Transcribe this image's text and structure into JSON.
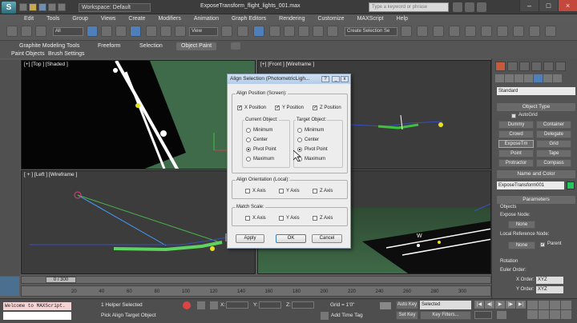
{
  "app": {
    "logo": "S",
    "title": "ExposeTransform_flight_lights_001.max",
    "workspace": "Workspace: Default",
    "search_placeholder": "Type a keyword or phrase",
    "window_buttons": [
      "–",
      "□",
      "×"
    ]
  },
  "menu": [
    "Edit",
    "Tools",
    "Group",
    "Views",
    "Create",
    "Modifiers",
    "Animation",
    "Graph Editors",
    "Rendering",
    "Customize",
    "MAXScript",
    "Help"
  ],
  "toolbar": {
    "filter": "All",
    "ref_coord": "View",
    "selection_set": "Create Selection Se"
  },
  "ribbon": {
    "tabs": [
      "Graphite Modeling Tools",
      "Freeform",
      "Selection",
      "Object Paint"
    ],
    "active": "Object Paint",
    "subtabs": [
      "Paint Objects",
      "Brush Settings"
    ]
  },
  "viewports": {
    "top": "[+] [Top ] [Shaded ]",
    "front": "[+] [Front ] [Wireframe ]",
    "left": "[ + ] [Left ] [Wireframe ]",
    "persp": "W"
  },
  "dialog": {
    "title": "Align Selection (PhotometricLigh...",
    "pos_group": "Align Position (Screen):",
    "axes": [
      {
        "label": "X Position",
        "checked": true
      },
      {
        "label": "Y Position",
        "checked": true
      },
      {
        "label": "Z Position",
        "checked": true
      }
    ],
    "current_label": "Current Object:",
    "target_label": "Target Object:",
    "current_opts": [
      "Minimum",
      "Center",
      "Pivot Point",
      "Maximum"
    ],
    "current_selected": "Pivot Point",
    "target_opts": [
      "Minimum",
      "Center",
      "Pivot Point",
      "Maximum"
    ],
    "target_selected": "Pivot Point",
    "orient_group": "Align Orientation (Local):",
    "orient": [
      "X Axis",
      "Y Axis",
      "Z Axis"
    ],
    "scale_group": "Match Scale:",
    "scale": [
      "X Axis",
      "Y Axis",
      "Z Axis"
    ],
    "buttons": {
      "apply": "Apply",
      "ok": "OK",
      "cancel": "Cancel"
    }
  },
  "cmd": {
    "category": "Standard",
    "object_type": "Object Type",
    "autogrid": "AutoGrid",
    "buttons": [
      "Dummy",
      "Container",
      "Crowd",
      "Delegate",
      "ExposeTm",
      "Grid",
      "Point",
      "Tape",
      "Protractor",
      "Compass"
    ],
    "name_color": "Name and Color",
    "name": "ExposeTransform001",
    "parameters": "Parameters",
    "objects": "Objects",
    "expose_node": "Expose Node:",
    "none1": "None",
    "local_ref": "Local Reference Node:",
    "none2": "None",
    "parent": "Parent",
    "rotation": "Rotation",
    "euler": "Euler Order:",
    "xorder": "X Order:",
    "xorder_val": "XYZ",
    "yorder": "Y Order:",
    "yorder_val": "XYZ"
  },
  "status": {
    "frame": "0 / 300",
    "ticks": [
      "20",
      "40",
      "60",
      "80",
      "100",
      "120",
      "140",
      "160",
      "180",
      "200",
      "220",
      "240",
      "260",
      "280",
      "300"
    ],
    "maxscript": "Welcome to MAXScript.",
    "selected": "1 Helper Selected",
    "prompt": "Pick Align Target Object",
    "x": "X:",
    "y": "Y:",
    "z": "Z:",
    "grid": "Grid = 1'0\"",
    "add_time_tag": "Add Time Tag",
    "auto_key": "Auto Key",
    "set_key": "Set Key",
    "key_sel": "Selected",
    "key_filters": "Key Filters..."
  },
  "colors": {
    "accent": "#4f7fb8",
    "viewport_green": "#3f6b4a",
    "dialog_bg": "#ededed"
  }
}
